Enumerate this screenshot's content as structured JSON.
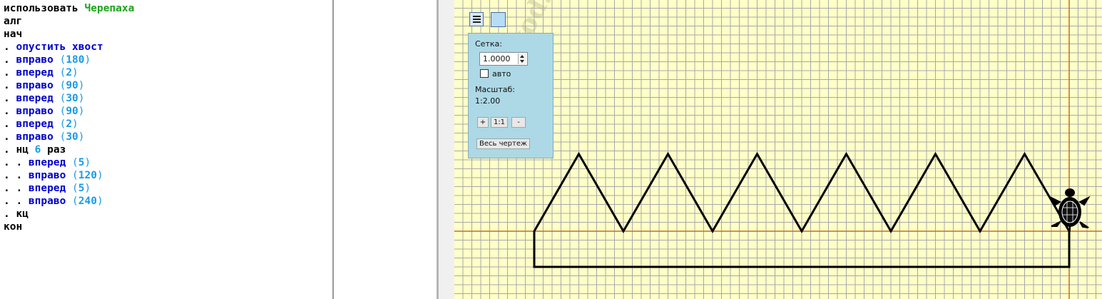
{
  "editor": {
    "lines": [
      {
        "parts": [
          {
            "t": "использовать ",
            "c": "kw"
          },
          {
            "t": "Черепаха",
            "c": "mod"
          }
        ]
      },
      {
        "parts": [
          {
            "t": "алг",
            "c": "kw"
          }
        ]
      },
      {
        "parts": [
          {
            "t": "нач",
            "c": "kw"
          }
        ]
      },
      {
        "parts": [
          {
            "t": ". ",
            "c": "dots"
          },
          {
            "t": "опустить хвост",
            "c": "cmd"
          }
        ]
      },
      {
        "parts": [
          {
            "t": ". ",
            "c": "dots"
          },
          {
            "t": "вправо ",
            "c": "cmd"
          },
          {
            "t": "(",
            "c": "paren"
          },
          {
            "t": "180",
            "c": "num"
          },
          {
            "t": ")",
            "c": "paren"
          }
        ]
      },
      {
        "parts": [
          {
            "t": ". ",
            "c": "dots"
          },
          {
            "t": "вперед ",
            "c": "cmd"
          },
          {
            "t": "(",
            "c": "paren"
          },
          {
            "t": "2",
            "c": "num"
          },
          {
            "t": ")",
            "c": "paren"
          }
        ]
      },
      {
        "parts": [
          {
            "t": ". ",
            "c": "dots"
          },
          {
            "t": "вправо ",
            "c": "cmd"
          },
          {
            "t": "(",
            "c": "paren"
          },
          {
            "t": "90",
            "c": "num"
          },
          {
            "t": ")",
            "c": "paren"
          }
        ]
      },
      {
        "parts": [
          {
            "t": ". ",
            "c": "dots"
          },
          {
            "t": "вперед ",
            "c": "cmd"
          },
          {
            "t": "(",
            "c": "paren"
          },
          {
            "t": "30",
            "c": "num"
          },
          {
            "t": ")",
            "c": "paren"
          }
        ]
      },
      {
        "parts": [
          {
            "t": ". ",
            "c": "dots"
          },
          {
            "t": "вправо ",
            "c": "cmd"
          },
          {
            "t": "(",
            "c": "paren"
          },
          {
            "t": "90",
            "c": "num"
          },
          {
            "t": ")",
            "c": "paren"
          }
        ]
      },
      {
        "parts": [
          {
            "t": ". ",
            "c": "dots"
          },
          {
            "t": "вперед ",
            "c": "cmd"
          },
          {
            "t": "(",
            "c": "paren"
          },
          {
            "t": "2",
            "c": "num"
          },
          {
            "t": ")",
            "c": "paren"
          }
        ]
      },
      {
        "parts": [
          {
            "t": ". ",
            "c": "dots"
          },
          {
            "t": "вправо ",
            "c": "cmd"
          },
          {
            "t": "(",
            "c": "paren"
          },
          {
            "t": "30",
            "c": "num"
          },
          {
            "t": ")",
            "c": "paren"
          }
        ]
      },
      {
        "parts": [
          {
            "t": ". ",
            "c": "dots"
          },
          {
            "t": "нц ",
            "c": "kw"
          },
          {
            "t": "6",
            "c": "num"
          },
          {
            "t": " раз",
            "c": "kw"
          }
        ]
      },
      {
        "parts": [
          {
            "t": ". . ",
            "c": "dots"
          },
          {
            "t": "вперед ",
            "c": "cmd"
          },
          {
            "t": "(",
            "c": "paren"
          },
          {
            "t": "5",
            "c": "num"
          },
          {
            "t": ")",
            "c": "paren"
          }
        ]
      },
      {
        "parts": [
          {
            "t": ". . ",
            "c": "dots"
          },
          {
            "t": "вправо ",
            "c": "cmd"
          },
          {
            "t": "(",
            "c": "paren"
          },
          {
            "t": "120",
            "c": "num"
          },
          {
            "t": ")",
            "c": "paren"
          }
        ]
      },
      {
        "parts": [
          {
            "t": ". . ",
            "c": "dots"
          },
          {
            "t": "вперед ",
            "c": "cmd"
          },
          {
            "t": "(",
            "c": "paren"
          },
          {
            "t": "5",
            "c": "num"
          },
          {
            "t": ")",
            "c": "paren"
          }
        ]
      },
      {
        "parts": [
          {
            "t": ". . ",
            "c": "dots"
          },
          {
            "t": "вправо ",
            "c": "cmd"
          },
          {
            "t": "(",
            "c": "paren"
          },
          {
            "t": "240",
            "c": "num"
          },
          {
            "t": ")",
            "c": "paren"
          }
        ]
      },
      {
        "parts": [
          {
            "t": ". ",
            "c": "dots"
          },
          {
            "t": "кц",
            "c": "kw"
          }
        ]
      },
      {
        "parts": [
          {
            "t": "кон",
            "c": "kw"
          }
        ]
      }
    ]
  },
  "settings": {
    "grid_label": "Сетка:",
    "grid_value": "1.0000",
    "auto_label": "авто",
    "auto_checked": false,
    "scale_label": "Масштаб:",
    "scale_value": "1:2.00",
    "zoom_in_label": "+",
    "zoom_reset_label": "1:1",
    "zoom_out_label": "-",
    "fit_label": "Весь чертеж"
  },
  "toolbar": {
    "menu_icon": "menu-icon",
    "color_icon": "color-swatch-icon"
  },
  "watermark": "klub-kod.ru",
  "drawing": {
    "program": {
      "start_heading_deg": 0,
      "commands": [
        {
          "cmd": "right",
          "value": 180
        },
        {
          "cmd": "forward",
          "value": 2
        },
        {
          "cmd": "right",
          "value": 90
        },
        {
          "cmd": "forward",
          "value": 30
        },
        {
          "cmd": "right",
          "value": 90
        },
        {
          "cmd": "forward",
          "value": 2
        },
        {
          "cmd": "right",
          "value": 30
        },
        {
          "repeat": 6,
          "body": [
            {
              "cmd": "forward",
              "value": 5
            },
            {
              "cmd": "right",
              "value": 120
            },
            {
              "cmd": "forward",
              "value": 5
            },
            {
              "cmd": "right",
              "value": 240
            }
          ]
        }
      ]
    },
    "colors": {
      "background": "#ffffc8",
      "grid": "#a8a8a8",
      "axis": "#c07020",
      "pen": "#000000"
    }
  }
}
